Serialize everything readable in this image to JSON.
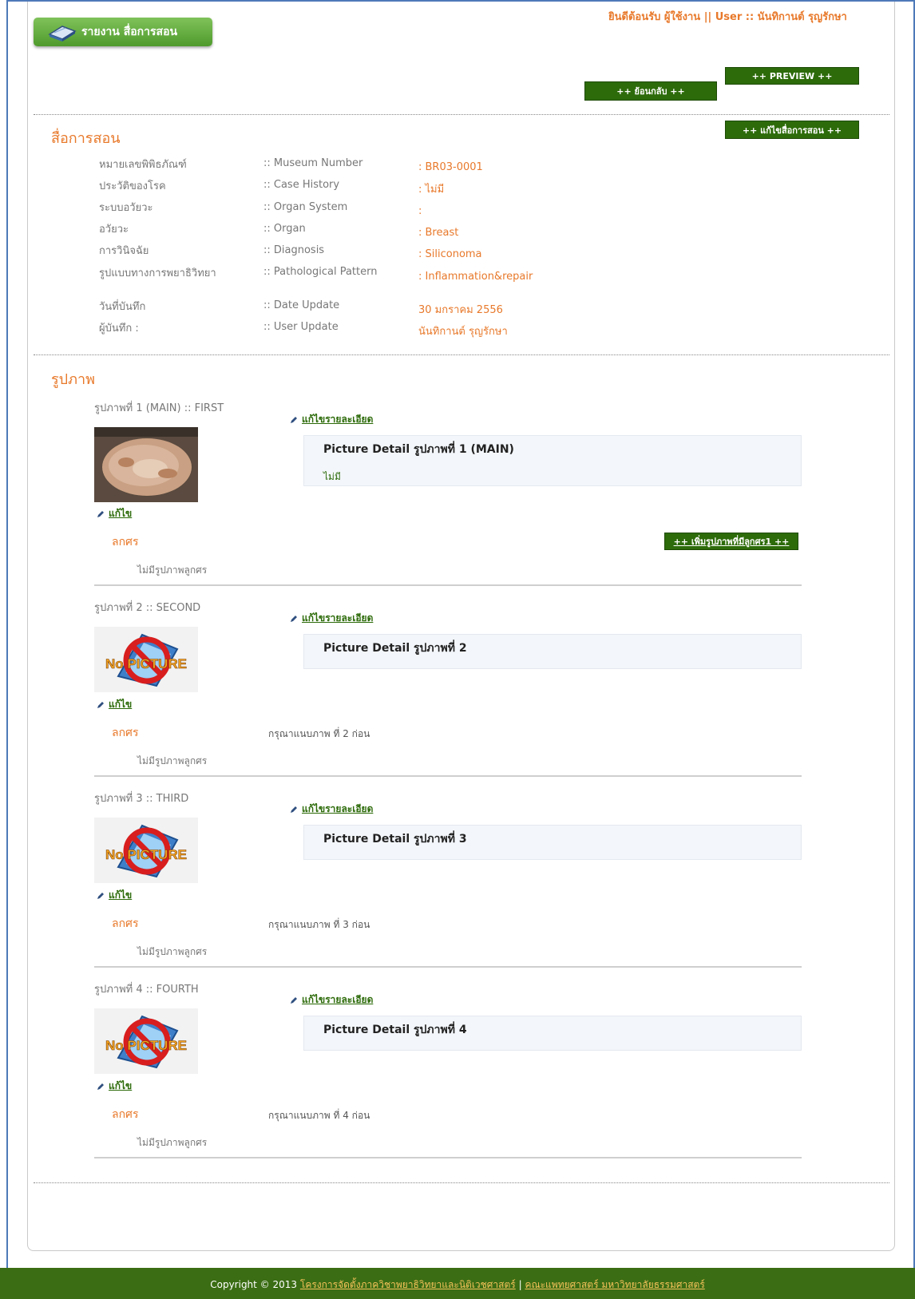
{
  "header": {
    "title_button": "รายงาน สื่อการสอน",
    "welcome": "ยินดีต้อนรับ ผู้ใช้งาน || User :: นันทิกานต์ รุญรักษา",
    "preview_button": "++ PREVIEW ++",
    "back_button": "++ ย้อนกลับ ++"
  },
  "media": {
    "section_title": "สื่อการสอน",
    "edit_button": "++ แก้ไขสื่อการสอน ++",
    "fields": [
      {
        "th": "หมายเลขพิพิธภัณฑ์",
        "en": ":: Museum Number",
        "value": ": BR03-0001"
      },
      {
        "th": "ประวัติของโรค",
        "en": ":: Case History",
        "value": ": ไม่มี"
      },
      {
        "th": "ระบบอวัยวะ",
        "en": ":: Organ System",
        "value": ":"
      },
      {
        "th": "อวัยวะ",
        "en": ":: Organ",
        "value": ": Breast"
      },
      {
        "th": "การวินิจฉัย",
        "en": ":: Diagnosis",
        "value": ": Siliconoma"
      },
      {
        "th": "รูปแบบทางการพยาธิวิทยา",
        "en": ":: Pathological Pattern",
        "value": ": Inflammation&repair"
      },
      {
        "th": "วันที่บันทึก",
        "en": ":: Date Update",
        "value": "30 มกราคม 2556"
      },
      {
        "th": "ผู้บันทึก :",
        "en": ":: User Update",
        "value": "นันทิกานต์ รุญรักษา"
      }
    ]
  },
  "pictures": {
    "section_title": "รูปภาพ",
    "edit_detail_label": "แก้ไขรายละเอียด",
    "edit_label": "แก้ไข",
    "sub_label": "ลกศร",
    "no_sub_text": "ไม่มีรูปภาพลูกศร",
    "add_sub_button": "++ เพิ่มรูปภาพที่มีลูกศร1 ++",
    "no_picture_text": "No PICTURE",
    "items": [
      {
        "title": "รูปภาพที่ 1 (MAIN) :: FIRST",
        "detail_title": "Picture Detail รูปภาพที่ 1 (MAIN)",
        "detail_text": "ไม่มี",
        "pending": ""
      },
      {
        "title": "รูปภาพที่ 2 :: SECOND",
        "detail_title": "Picture Detail รูปภาพที่ 2",
        "detail_text": "",
        "pending": "กรุณาแนบภาพ ที่ 2 ก่อน"
      },
      {
        "title": "รูปภาพที่ 3 :: THIRD",
        "detail_title": "Picture Detail รูปภาพที่ 3",
        "detail_text": "",
        "pending": "กรุณาแนบภาพ ที่ 3 ก่อน"
      },
      {
        "title": "รูปภาพที่ 4 :: FOURTH",
        "detail_title": "Picture Detail รูปภาพที่ 4",
        "detail_text": "",
        "pending": "กรุณาแนบภาพ ที่ 4 ก่อน"
      }
    ]
  },
  "footer": {
    "copyright": "Copyright © 2013",
    "link1": "โครงการจัดตั้งภาควิชาพยาธิวิทยาและนิติเวชศาสตร์",
    "separator": "|",
    "link2": "คณะแพทยศาสตร์ มหาวิทยาลัยธรรมศาสตร์"
  },
  "colors": {
    "accent": "#e8792b",
    "green": "#2d6b0a",
    "frame": "#4d79b8"
  }
}
